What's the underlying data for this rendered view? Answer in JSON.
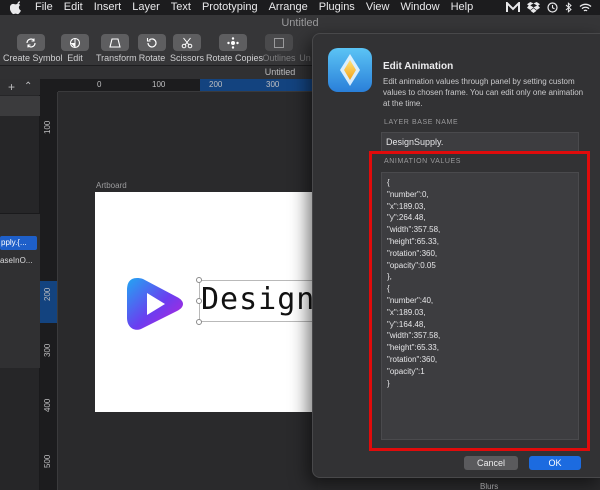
{
  "menubar": {
    "items": [
      "File",
      "Edit",
      "Insert",
      "Layer",
      "Text",
      "Prototyping",
      "Arrange",
      "Plugins",
      "View",
      "Window",
      "Help"
    ]
  },
  "window": {
    "title": "Untitled",
    "doc_tab": "Untitled"
  },
  "toolbar": {
    "tools": [
      {
        "label": "Create Symbol",
        "icon": "create-symbol-icon"
      },
      {
        "label": "Edit",
        "icon": "edit-icon"
      },
      {
        "label": "Transform",
        "icon": "transform-icon"
      },
      {
        "label": "Rotate",
        "icon": "rotate-icon"
      },
      {
        "label": "Scissors",
        "icon": "scissors-icon"
      },
      {
        "label": "Rotate Copies",
        "icon": "rotate-copies-icon"
      },
      {
        "label": "Outlines",
        "icon": "outlines-icon"
      },
      {
        "label": "Un",
        "icon": "union-icon"
      }
    ]
  },
  "left_panel": {
    "layer_selected": "pply.{...",
    "layer_other": "aseInO..."
  },
  "rulers": {
    "horizontal": [
      "0",
      "100",
      "200",
      "300"
    ],
    "vertical": [
      "100",
      "200",
      "300",
      "400",
      "500"
    ]
  },
  "canvas": {
    "artboard_label": "Artboard",
    "wordmark": "DesignS"
  },
  "dialog": {
    "title": "Edit Animation",
    "description": "Edit animation values through panel by setting custom values to chosen frame. You can edit only one animation at the time.",
    "layer_base_name_label": "LAYER BASE NAME",
    "layer_base_name_value": "DesignSupply.",
    "animation_values_label": "ANIMATION VALUES",
    "animation_values_lines": [
      "{",
      "\"number\":0,",
      "\"x\":189.03,",
      "\"y\":264.48,",
      "\"width\":357.58,",
      "\"height\":65.33,",
      "\"rotation\":360,",
      "\"opacity\":0.05",
      "},",
      "{",
      "\"number\":40,",
      "\"x\":189.03,",
      "\"y\":164.48,",
      "\"width\":357.58,",
      "\"height\":65.33,",
      "\"rotation\":360,",
      "\"opacity\":1",
      "}"
    ],
    "cancel_label": "Cancel",
    "ok_label": "OK"
  },
  "right_panel": {
    "blurs_label": "Blurs"
  },
  "colors": {
    "accent": "#1c6be0",
    "highlight_border": "#e00b0b",
    "selection": "#1e5fc9"
  }
}
